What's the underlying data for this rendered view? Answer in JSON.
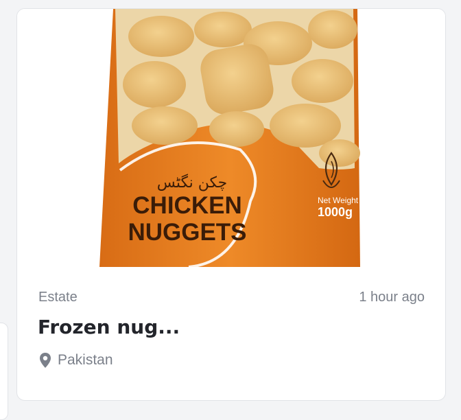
{
  "listing": {
    "category": "Estate",
    "posted": "1 hour ago",
    "title": "Frozen nug...",
    "location": "Pakistan",
    "location_icon": "map-pin-icon",
    "image": {
      "urdu_text": "چکن نگٹس",
      "line1": "CHICKEN",
      "line2": "NUGGETS",
      "net_weight_label": "Net Weight",
      "net_weight_value": "1000g"
    }
  },
  "colors": {
    "package_orange": "#e8801f",
    "text_dark": "#23252b",
    "text_muted": "#7b808a"
  }
}
